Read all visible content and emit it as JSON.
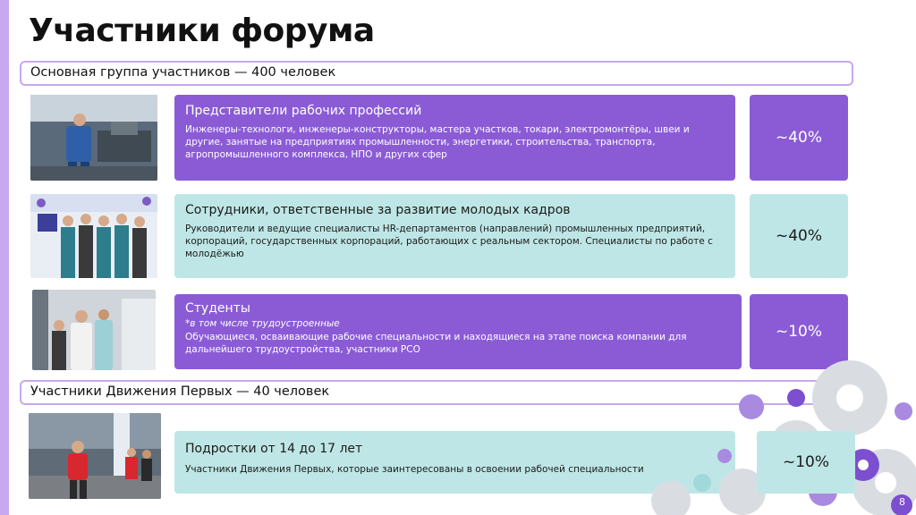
{
  "title": "Участники форума",
  "sections": [
    {
      "label": "Основная группа участников — 400 человек"
    },
    {
      "label": "Участники Движения Первых — 40 человек"
    }
  ],
  "rows": [
    {
      "heading": "Представители рабочих профессий",
      "text": "Инженеры-технологи, инженеры-конструкторы, мастера участков, токари, электромонтёры, швеи и другие, занятые на предприятиях промышленности, энергетики, строительства, транспорта, агропромышленного комплекса, НПО и других сфер",
      "percent": "~40%"
    },
    {
      "heading": "Сотрудники, ответственные за развитие молодых кадров",
      "text": "Руководители и ведущие специалисты HR-департаментов (направлений) промышленных предприятий, корпораций, государственных корпораций, работающих с реальным сектором. Специалисты по работе с молодёжью",
      "percent": "~40%"
    },
    {
      "heading": "Студенты",
      "note": "*в том числе трудоустроенные",
      "text": "Обучающиеся, осваивающие рабочие специальности и находящиеся на этапе поиска компании для дальнейшего трудоустройства, участники РСО",
      "percent": "~10%"
    },
    {
      "heading": "Подростки от 14 до 17 лет",
      "text": "Участники Движения Первых, которые заинтересованы в освоении рабочей специальности",
      "percent": "~10%"
    }
  ],
  "page_number": "8",
  "colors": {
    "purple": "#8b5bd6",
    "teal": "#bfe6e6",
    "border": "#c7a8ee"
  }
}
